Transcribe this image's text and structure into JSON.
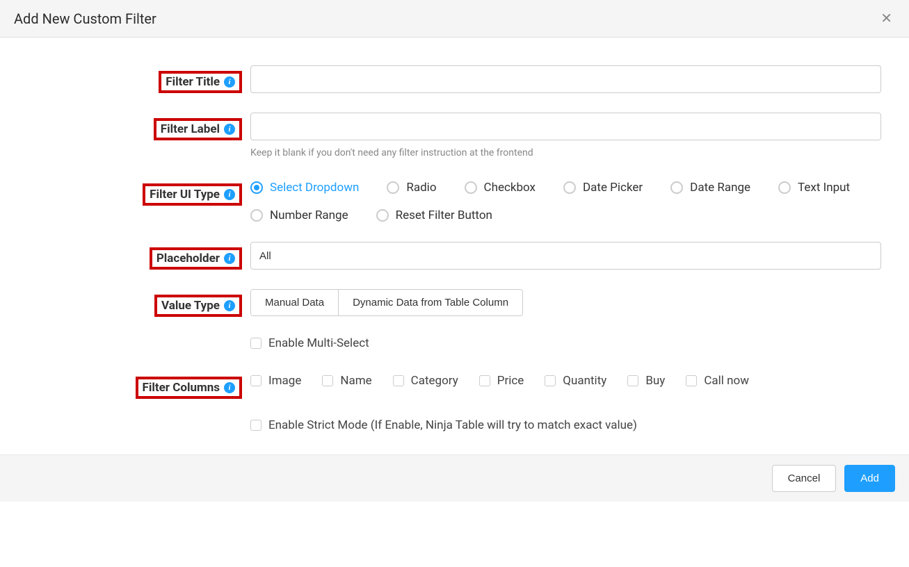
{
  "header": {
    "title": "Add New Custom Filter"
  },
  "labels": {
    "filter_title": "Filter Title",
    "filter_label": "Filter Label",
    "filter_ui_type": "Filter UI Type",
    "placeholder": "Placeholder",
    "value_type": "Value Type",
    "filter_columns": "Filter Columns"
  },
  "help": {
    "filter_label": "Keep it blank if you don't need any filter instruction at the frontend"
  },
  "values": {
    "filter_title": "",
    "filter_label": "",
    "placeholder": "All"
  },
  "ui_types": {
    "select_dropdown": "Select Dropdown",
    "radio": "Radio",
    "checkbox": "Checkbox",
    "date_picker": "Date Picker",
    "date_range": "Date Range",
    "text_input": "Text Input",
    "number_range": "Number Range",
    "reset_filter": "Reset Filter Button"
  },
  "value_type_options": {
    "manual": "Manual Data",
    "dynamic": "Dynamic Data from Table Column"
  },
  "options": {
    "enable_multi_select": "Enable Multi-Select",
    "enable_strict_mode": "Enable Strict Mode (If Enable, Ninja Table will try to match exact value)"
  },
  "filter_columns": {
    "image": "Image",
    "name": "Name",
    "category": "Category",
    "price": "Price",
    "quantity": "Quantity",
    "buy": "Buy",
    "call_now": "Call now"
  },
  "footer": {
    "cancel": "Cancel",
    "add": "Add"
  }
}
